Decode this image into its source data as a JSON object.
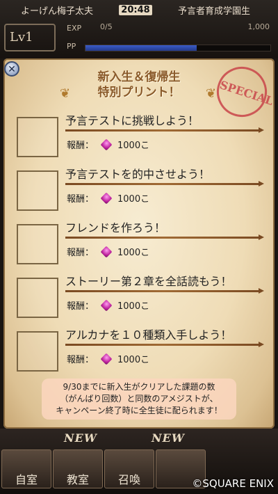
{
  "header": {
    "user_name": "よーげん梅子太夫",
    "time": "20:48",
    "school": "予言者育成学園生",
    "level_label": "Lv1",
    "exp_label": "EXP",
    "exp_value": "0/5",
    "pp_label": "PP",
    "stat_value": "1,000"
  },
  "dialog": {
    "title_line1": "新入生＆復帰生",
    "title_line2": "特別プリント！",
    "stamp_text": "SPECIAL",
    "tasks": [
      {
        "title": "予言テストに挑戦しよう！",
        "reward_label": "報酬：",
        "reward_amount": "1000こ"
      },
      {
        "title": "予言テストを的中させよう！",
        "reward_label": "報酬：",
        "reward_amount": "1000こ"
      },
      {
        "title": "フレンドを作ろう！",
        "reward_label": "報酬：",
        "reward_amount": "1000こ"
      },
      {
        "title": "ストーリー第２章を全話読もう！",
        "reward_label": "報酬：",
        "reward_amount": "1000こ"
      },
      {
        "title": "アルカナを１０種類入手しよう！",
        "reward_label": "報酬：",
        "reward_amount": "1000こ"
      }
    ],
    "notice_line1": "9/30までに新入生がクリアした課題の数",
    "notice_line2": "（がんばり回数）と同数のアメジストが、",
    "notice_line3": "キャンペーン終了時に全生徒に配られます！"
  },
  "bottom_nav": {
    "items": [
      {
        "label": "自室"
      },
      {
        "label": "教室"
      },
      {
        "label": "召喚"
      }
    ],
    "new_badge": "NEW",
    "copyright": "©SQUARE ENIX"
  },
  "colors": {
    "title": "#8a5a2a",
    "stamp": "#c9454a",
    "gem": "#c0259f"
  }
}
